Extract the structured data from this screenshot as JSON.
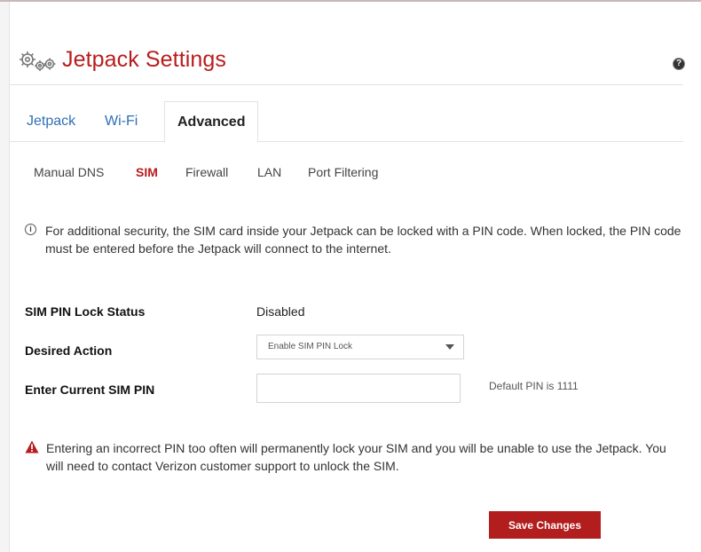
{
  "header": {
    "title": "Jetpack Settings",
    "title_color": "#b91c1c",
    "help_icon": "question-circle-icon",
    "settings_icon": "gears-icon"
  },
  "tabs": [
    {
      "label": "Jetpack",
      "active": false
    },
    {
      "label": "Wi-Fi",
      "active": false
    },
    {
      "label": "Advanced",
      "active": true
    }
  ],
  "subtabs": [
    {
      "label": "Manual DNS",
      "active": false
    },
    {
      "label": "SIM",
      "active": true
    },
    {
      "label": "Firewall",
      "active": false
    },
    {
      "label": "LAN",
      "active": false
    },
    {
      "label": "Port Filtering",
      "active": false
    }
  ],
  "info": {
    "icon": "info-icon",
    "text": "For additional security, the SIM card inside your Jetpack can be locked with a PIN code. When locked, the PIN code must be entered before the Jetpack will connect to the internet."
  },
  "form": {
    "status_label": "SIM PIN Lock Status",
    "status_value": "Disabled",
    "action_label": "Desired Action",
    "action_value": "Enable SIM PIN Lock",
    "pin_label": "Enter Current SIM PIN",
    "pin_value": "",
    "pin_hint": "Default PIN is 1111"
  },
  "warning": {
    "icon": "warning-triangle-icon",
    "text": "Entering an incorrect PIN too often will permanently lock your SIM and you will be unable to use the Jetpack. You will need to contact Verizon customer support to unlock the SIM."
  },
  "actions": {
    "save_label": "Save Changes",
    "save_color": "#b21d1d"
  }
}
